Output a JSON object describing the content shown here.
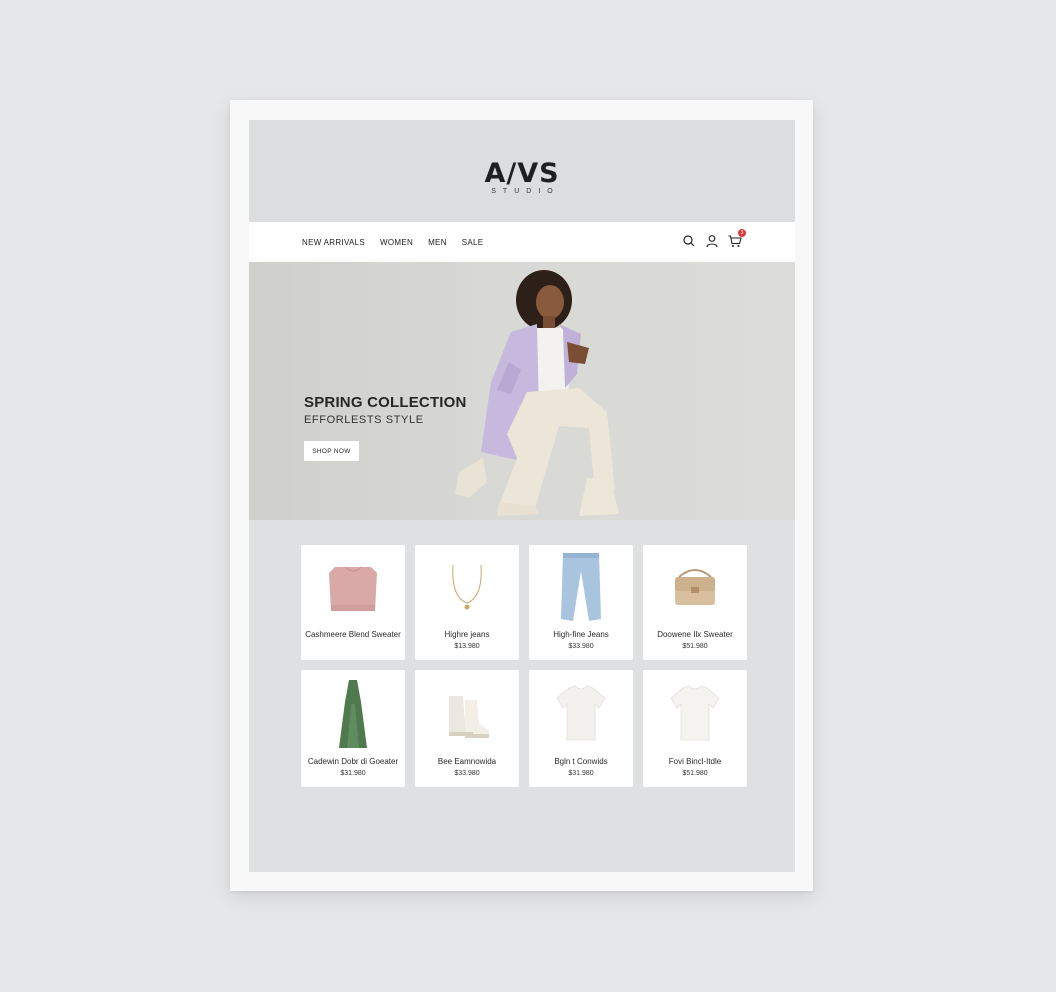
{
  "brand": {
    "logo": "A/VS",
    "subtitle": "STUDIO"
  },
  "nav": {
    "links": [
      "NEW ARRIVALS",
      "WOMEN",
      "MEN",
      "SALE"
    ],
    "icons": [
      "search-icon",
      "user-icon",
      "cart-icon"
    ],
    "cart_count": "3"
  },
  "hero": {
    "title": "SPRING COLLECTION",
    "subtitle": "EFFORLESTS STYLE",
    "button": "SHOP NOW"
  },
  "products": [
    {
      "name": "Cashmeere Blend Sweater",
      "price": "",
      "image": "pink-sweater"
    },
    {
      "name": "Highre jeans",
      "price": "$13.980",
      "image": "gold-necklace"
    },
    {
      "name": "High-fine Jeans",
      "price": "$33.980",
      "image": "blue-jeans"
    },
    {
      "name": "Doowene Ilx Sweater",
      "price": "$51.980",
      "image": "beige-handbag"
    },
    {
      "name": "Cadewin Dobr di Goeater",
      "price": "$31.980",
      "image": "green-dress"
    },
    {
      "name": "Bee Eamnowida",
      "price": "$33.980",
      "image": "white-boots"
    },
    {
      "name": "Bgln t Conwids",
      "price": "$31.980",
      "image": "white-tshirt"
    },
    {
      "name": "Fovi Bincl-Itdle",
      "price": "$51.980",
      "image": "white-tshirt"
    }
  ],
  "colors": {
    "background": "#e6e7e9",
    "page": "#dfe0e2",
    "cart_badge": "#e0393e",
    "coat": "#c5b8dc",
    "dress": "#4e7a4e"
  }
}
